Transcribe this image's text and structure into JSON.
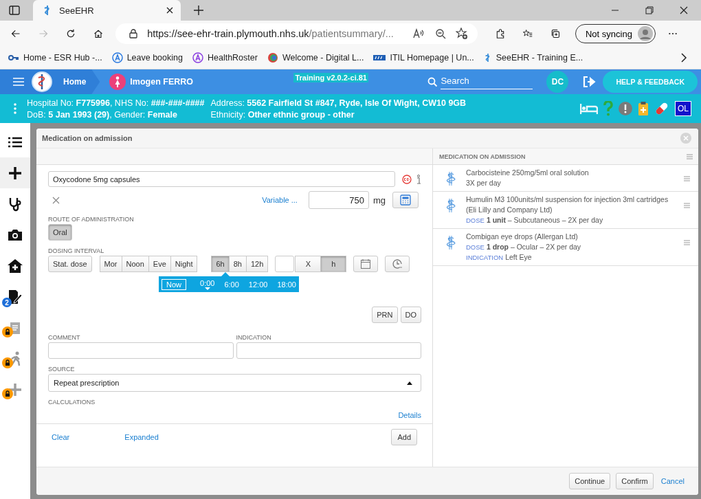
{
  "browser": {
    "tab": {
      "title": "SeeEHR"
    },
    "url": {
      "host": "https://see-ehr-train.plymouth.nhs.uk",
      "path": "/patientsummary/..."
    },
    "profile": {
      "label": "Not syncing"
    },
    "bookmarks": [
      {
        "label": "Home - ESR Hub -..."
      },
      {
        "label": "Leave booking"
      },
      {
        "label": "HealthRoster"
      },
      {
        "label": "Welcome - Digital L..."
      },
      {
        "label": "ITIL Homepage | Un..."
      },
      {
        "label": "SeeEHR - Training E..."
      }
    ]
  },
  "header": {
    "home": "Home",
    "patient": "Imogen FERRO",
    "version": "Training v2.0.2-ci.81",
    "search": {
      "placeholder": "Search"
    },
    "user": "DC",
    "help": "HELP & FEEDBACK"
  },
  "banner": {
    "left": [
      "Hospital No: **F775996**, NHS No: **###-###-####**",
      "DoB: **5 Jan 1993 (29)**, Gender: **Female**"
    ],
    "right": [
      "Address: **5562 Fairfield St #847, Ryde, Isle Of Wight, CW10 9GB**",
      "Ethnicity: **Other ethnic group - other**"
    ],
    "badge": "OL"
  },
  "sidebar": {
    "items": [
      {
        "selected": false,
        "locked": false
      },
      {
        "selected": true,
        "locked": false
      },
      {
        "selected": false,
        "locked": false
      },
      {
        "selected": false,
        "locked": false
      },
      {
        "selected": false,
        "locked": false
      },
      {
        "selected": false,
        "locked": false,
        "badge": "2"
      },
      {
        "selected": false,
        "locked": true
      },
      {
        "selected": false,
        "locked": true
      },
      {
        "selected": false,
        "locked": true
      }
    ]
  },
  "modal": {
    "title": "Medication on admission",
    "drug": {
      "value": "Oxycodone 5mg capsules"
    },
    "variable": "Variable ...",
    "dose": {
      "value": "750"
    },
    "unit": "mg",
    "route": {
      "label": "ROUTE OF ADMINISTRATION",
      "options": [
        {
          "label": "Oral",
          "selected": true
        }
      ]
    },
    "dosing": {
      "label": "DOSING INTERVAL",
      "stat": {
        "label": "Stat. dose",
        "selected": false
      },
      "times": [
        {
          "label": "Mor",
          "selected": false
        },
        {
          "label": "Noon",
          "selected": false
        },
        {
          "label": "Eve",
          "selected": false
        },
        {
          "label": "Night",
          "selected": false
        }
      ],
      "intervals": [
        {
          "label": "6h",
          "selected": true
        },
        {
          "label": "8h",
          "selected": false
        },
        {
          "label": "12h",
          "selected": false
        }
      ],
      "units": [
        {
          "label": "X",
          "selected": false
        },
        {
          "label": "h",
          "selected": true
        }
      ],
      "timeline": [
        {
          "label": "Now",
          "selected": true,
          "first_dose": false
        },
        {
          "label": "0:00",
          "selected": false,
          "first_dose": true
        },
        {
          "label": "6:00",
          "selected": false,
          "first_dose": false
        },
        {
          "label": "12:00",
          "selected": false,
          "first_dose": false
        },
        {
          "label": "18:00",
          "selected": false,
          "first_dose": false
        }
      ]
    },
    "prn": "PRN",
    "do": "DO",
    "comment": {
      "label": "COMMENT"
    },
    "indication": {
      "label": "INDICATION"
    },
    "source": {
      "label": "SOURCE",
      "value": "Repeat prescription"
    },
    "calculations": {
      "label": "CALCULATIONS"
    },
    "details": "Details",
    "clear": "Clear",
    "expanded": "Expanded",
    "add": "Add",
    "list": {
      "title": "MEDICATION ON ADMISSION",
      "items": [
        {
          "name": "Carbocisteine 250mg/5ml oral solution",
          "lines": [
            {
              "text": "3X per day"
            }
          ]
        },
        {
          "name": "Humulin M3 100units/ml suspension for injection 3ml cartridges (Eli Lilly and Company Ltd)",
          "lines": [
            {
              "label": "DOSE",
              "text": "**1 unit** – Subcutaneous – 2X per day"
            }
          ]
        },
        {
          "name": "Combigan eye drops (Allergan Ltd)",
          "lines": [
            {
              "label": "DOSE",
              "text": "**1 drop** – Ocular – 2X per day"
            },
            {
              "label": "INDICATION",
              "text": "Left Eye"
            }
          ]
        }
      ]
    },
    "footer": {
      "continue": "Continue",
      "confirm": "Confirm",
      "cancel": "Cancel"
    }
  }
}
